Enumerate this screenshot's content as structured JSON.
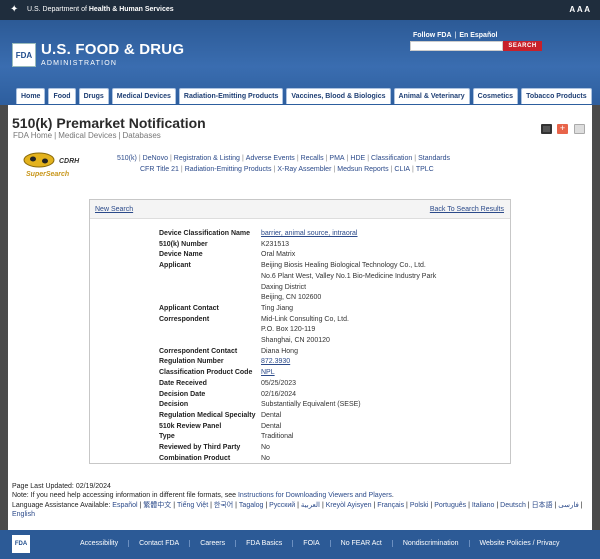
{
  "hhs": {
    "text_prefix": "U.S. Department of ",
    "text_bold": "Health & Human Services",
    "font_size_label": "A A A"
  },
  "header": {
    "logo": "FDA",
    "title": "U.S. FOOD & DRUG",
    "subtitle": "ADMINISTRATION",
    "follow": "Follow FDA",
    "divider": "|",
    "espanol": "En Español",
    "search_placeholder": "",
    "search_button": "SEARCH"
  },
  "nav": [
    "Home",
    "Food",
    "Drugs",
    "Medical Devices",
    "Radiation-Emitting Products",
    "Vaccines, Blood & Biologics",
    "Animal & Veterinary",
    "Cosmetics",
    "Tobacco Products"
  ],
  "page": {
    "title": "510(k) Premarket Notification",
    "crumbs": [
      "FDA Home",
      "Medical Devices",
      "Databases"
    ]
  },
  "cdrh": {
    "line1": "CDRH",
    "line2": "SuperSearch"
  },
  "links_row1": [
    "510(k)",
    "DeNovo",
    "Registration & Listing",
    "Adverse Events",
    "Recalls",
    "PMA",
    "HDE",
    "Classification",
    "Standards"
  ],
  "links_row2": [
    "CFR Title 21",
    "Radiation-Emitting Products",
    "X-Ray Assembler",
    "Medsun Reports",
    "CLIA",
    "TPLC"
  ],
  "panel": {
    "new_search": "New Search",
    "back": "Back To Search Results"
  },
  "record": [
    {
      "k": "Device Classification Name",
      "v": [
        "barrier, animal source, intraoral"
      ],
      "link": true
    },
    {
      "k": "510(k) Number",
      "v": [
        "K231513"
      ]
    },
    {
      "k": "Device Name",
      "v": [
        "Oral Matrix"
      ]
    },
    {
      "k": "Applicant",
      "v": [
        "Beijing Biosis Healing Biological Technology Co., Ltd.",
        "No.6 Plant West, Valley No.1 Bio-Medicine Industry Park",
        "Daxing District",
        "Beijing,  CN 102600"
      ]
    },
    {
      "k": "Applicant Contact",
      "v": [
        "Ting Jiang"
      ]
    },
    {
      "k": "Correspondent",
      "v": [
        "Mid-Link Consulting Co, Ltd.",
        "P.O. Box 120-119",
        "Shanghai,  CN 200120"
      ]
    },
    {
      "k": "Correspondent Contact",
      "v": [
        "Diana Hong"
      ]
    },
    {
      "k": "Regulation Number",
      "v": [
        "872.3930"
      ],
      "link": true
    },
    {
      "k": "Classification Product Code",
      "v": [
        "NPL"
      ],
      "link": true
    },
    {
      "k": "Date Received",
      "v": [
        "05/25/2023"
      ]
    },
    {
      "k": "Decision Date",
      "v": [
        "02/16/2024"
      ]
    },
    {
      "k": "Decision",
      "v": [
        "Substantially Equivalent (SESE)"
      ]
    },
    {
      "k": "Regulation Medical Specialty",
      "v": [
        "Dental"
      ]
    },
    {
      "k": "510k Review Panel",
      "v": [
        "Dental"
      ]
    },
    {
      "k": "Type",
      "v": [
        "Traditional"
      ]
    },
    {
      "k": "Reviewed by Third Party",
      "v": [
        "No"
      ]
    },
    {
      "k": "Combination Product",
      "v": [
        "No"
      ]
    }
  ],
  "footer": {
    "updated": "Page Last Updated: 02/19/2024",
    "note_prefix": "Note: If you need help accessing information in different file formats, see ",
    "note_link": "Instructions for Downloading Viewers and Players",
    "note_suffix": ".",
    "lang_label": "Language Assistance Available: ",
    "languages": [
      "Español",
      "繁體中文",
      "Tiếng Việt",
      "한국어",
      "Tagalog",
      "Русский",
      "العربية",
      "Kreyòl Ayisyen",
      "Français",
      "Polski",
      "Português",
      "Italiano",
      "Deutsch",
      "日本語",
      "فارسی",
      "English"
    ]
  },
  "bottom_logo": "FDA",
  "bottom_links": [
    "Accessibility",
    "Contact FDA",
    "Careers",
    "FDA Basics",
    "FOIA",
    "No FEAR Act",
    "Nondiscrimination",
    "Website Policies / Privacy"
  ],
  "colors": {
    "header_blue": "#2c5a96",
    "search_red": "#c8202a",
    "link": "#2b4a8a"
  }
}
